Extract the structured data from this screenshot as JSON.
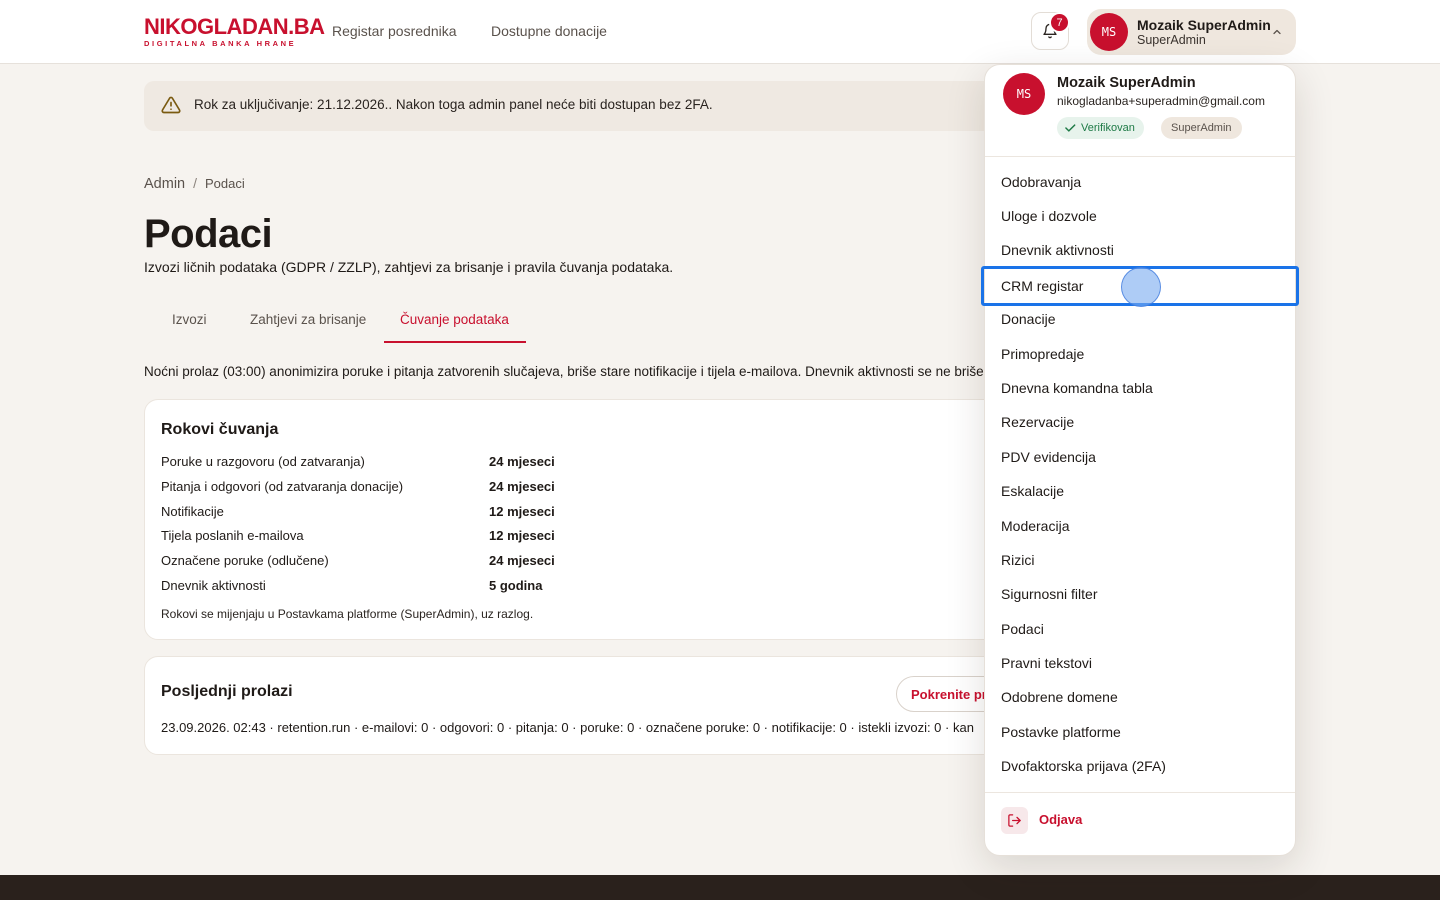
{
  "header": {
    "logo_main": "NIKOGLADAN.BA",
    "logo_sub": "DIGITALNA BANKA HRANE",
    "nav": [
      "Registar posrednika",
      "Dostupne donacije"
    ],
    "notifications_count": "7",
    "user_initials": "MS",
    "user_name": "Mozaik SuperAdmin",
    "user_role": "SuperAdmin"
  },
  "banner": {
    "icon": "warning-triangle-icon",
    "text": "Rok za uključivanje: 21.12.2026.. Nakon toga admin panel neće biti dostupan bez 2FA."
  },
  "breadcrumb": {
    "root": "Admin",
    "sep": "/",
    "current": "Podaci"
  },
  "page": {
    "title": "Podaci",
    "subtitle": "Izvozi ličnih podataka (GDPR / ZZLP), zahtjevi za brisanje i pravila čuvanja podataka."
  },
  "tabs": [
    "Izvozi",
    "Zahtjevi za brisanje",
    "Čuvanje podataka"
  ],
  "active_tab": "Čuvanje podataka",
  "note": "Noćni prolaz (03:00) anonimizira poruke i pitanja zatvorenih slučajeva, briše stare notifikacije i tijela e-mailova. Dnevnik aktivnosti se ne briše",
  "retention": {
    "title": "Rokovi čuvanja",
    "rows": [
      {
        "label": "Poruke u razgovoru (od zatvaranja)",
        "value": "24 mjeseci"
      },
      {
        "label": "Pitanja i odgovori (od zatvaranja donacije)",
        "value": "24 mjeseci"
      },
      {
        "label": "Notifikacije",
        "value": "12 mjeseci"
      },
      {
        "label": "Tijela poslanih e-mailova",
        "value": "12 mjeseci"
      },
      {
        "label": "Označene poruke (odlučene)",
        "value": "24 mjeseci"
      },
      {
        "label": "Dnevnik aktivnosti",
        "value": "5 godina"
      }
    ],
    "footer": "Rokovi se mijenjaju u Postavkama platforme (SuperAdmin), uz razlog."
  },
  "runs": {
    "title": "Posljednji prolazi",
    "button": "Pokrenite pr",
    "line": "23.09.2026. 02:43 · retention.run · e-mailovi: 0 · odgovori: 0 · pitanja: 0 · poruke: 0 · označene poruke: 0 · notifikacije: 0 · istekli izvozi: 0 · kan"
  },
  "dropdown": {
    "initials": "MS",
    "name": "Mozaik SuperAdmin",
    "email": "nikogladanba+superadmin@gmail.com",
    "verified": "Verifikovan",
    "role": "SuperAdmin",
    "items": [
      "Odobravanja",
      "Uloge i dozvole",
      "Dnevnik aktivnosti",
      "CRM registar",
      "Donacije",
      "Primopredaje",
      "Dnevna komandna tabla",
      "Rezervacije",
      "PDV evidencija",
      "Eskalacije",
      "Moderacija",
      "Rizici",
      "Sigurnosni filter",
      "Podaci",
      "Pravni tekstovi",
      "Odobrene domene",
      "Postavke platforme",
      "Dvofaktorska prijava (2FA)"
    ],
    "highlighted": "CRM registar",
    "logout": "Odjava"
  },
  "colors": {
    "brand": "#c8102e",
    "focus": "#1a73e8",
    "success": "#1e7a46"
  }
}
